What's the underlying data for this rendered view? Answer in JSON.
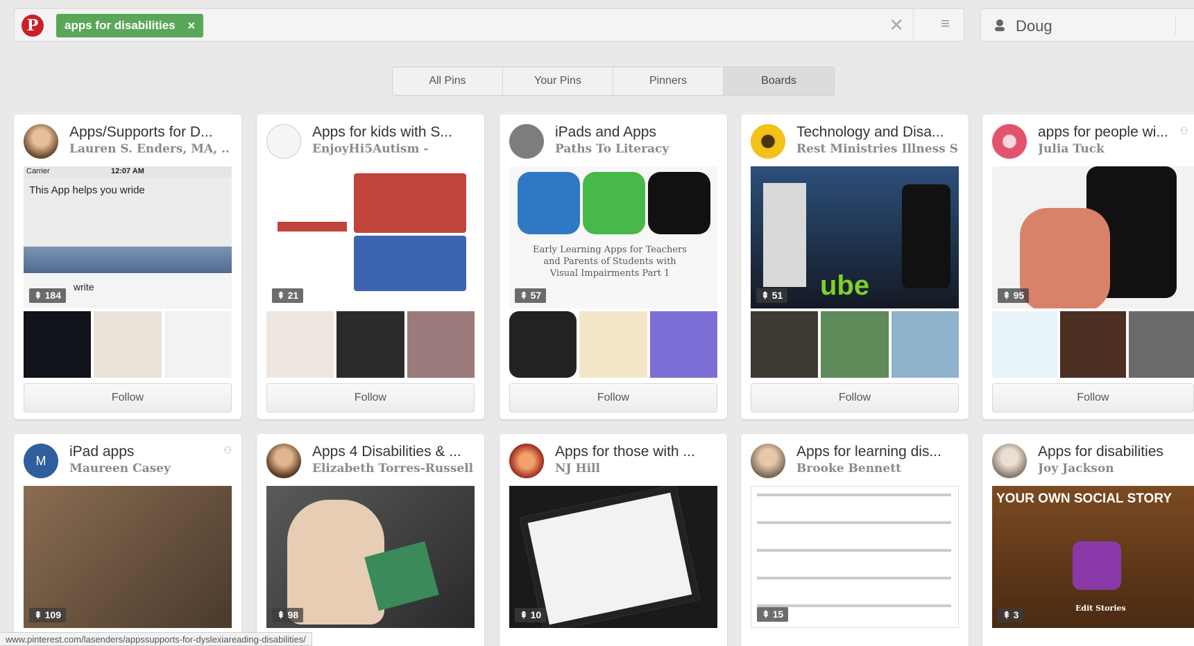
{
  "header": {
    "logo_letter": "P",
    "search_query": "apps for disabilities",
    "chip_close": "×",
    "clear_glyph": "✕",
    "menu_glyph": "≡",
    "user_name": "Doug"
  },
  "tabs": [
    {
      "label": "All Pins"
    },
    {
      "label": "Your Pins"
    },
    {
      "label": "Pinners"
    },
    {
      "label": "Boards"
    }
  ],
  "boards": [
    {
      "title": "Apps/Supports for D...",
      "owner": "Lauren S. Enders, MA, ...",
      "pins": "184",
      "follow": "Follow",
      "cover_text": "This App helps you wride",
      "cover_time": "12:07 AM",
      "cover_carrier": "Carrier",
      "cover_word": "write"
    },
    {
      "title": "Apps for kids with S...",
      "owner": "EnjoyHi5Autism -",
      "pins": "21",
      "follow": "Follow"
    },
    {
      "title": "iPads and Apps",
      "owner": "Paths To Literacy",
      "pins": "57",
      "follow": "Follow",
      "cover_caption": "Early Learning Apps for Teachers and Parents of Students with Visual Impairments Part 1"
    },
    {
      "title": "Technology and Disa...",
      "owner": "Rest Ministries Illness S...",
      "pins": "51",
      "follow": "Follow",
      "cover_word": "ube"
    },
    {
      "title": "apps for people wi...",
      "owner": "Julia Tuck",
      "pins": "95",
      "follow": "Follow"
    },
    {
      "title": "iPad apps",
      "owner": "Maureen Casey",
      "pins": "109",
      "avatar_letter": "M"
    },
    {
      "title": "Apps 4 Disabilities & ...",
      "owner": "Elizabeth Torres-Russell",
      "pins": "98"
    },
    {
      "title": "Apps for those with ...",
      "owner": "NJ Hill",
      "pins": "10"
    },
    {
      "title": "Apps for learning dis...",
      "owner": "Brooke Bennett",
      "pins": "15"
    },
    {
      "title": "Apps for disabilities",
      "owner": "Joy Jackson",
      "pins": "3",
      "cover_heading": "YOUR OWN SOCIAL STORY",
      "cover_sub": "Edit Stories"
    }
  ],
  "status_url": "www.pinterest.com/lasenders/appssupports-for-dyslexiareading-disabilities/",
  "colors": {
    "pinterest_red": "#cb2027",
    "chip_green": "#5aa75a"
  }
}
